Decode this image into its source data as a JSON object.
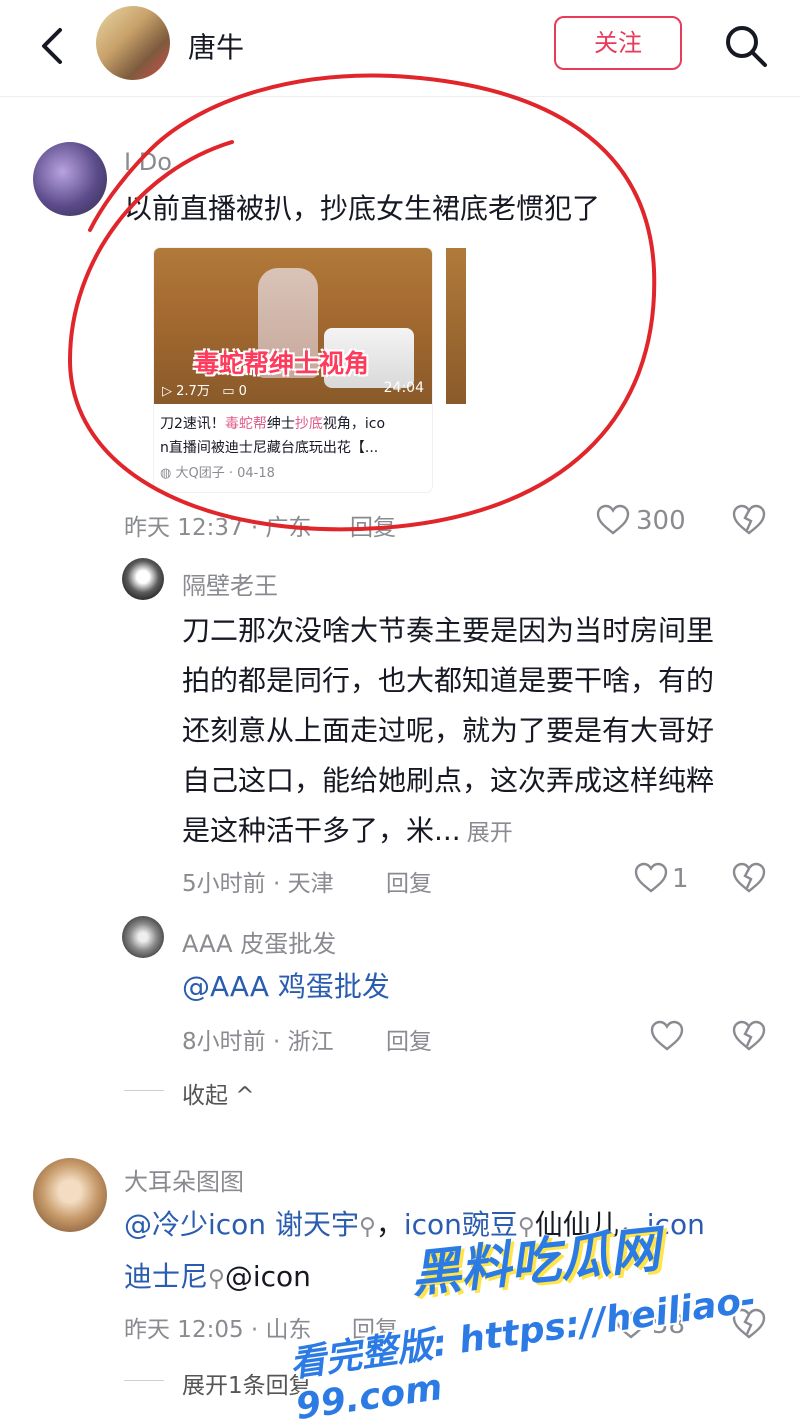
{
  "header": {
    "title": "唐牛",
    "follow_label": "关注"
  },
  "comments": [
    {
      "username": "I Do",
      "text": "以前直播被扒，抄底女生裙底老惯犯了",
      "video_card": {
        "overlay_title": "毒蛇帮绅士视角",
        "views": "2.7万",
        "comments": "0",
        "duration": "24:04",
        "caption_line1_parts": [
          "刀2速讯！",
          "毒蛇帮",
          "绅士",
          "抄底",
          "视角，ico"
        ],
        "caption_line2": "n直播间被迪士尼藏台底玩出花【...",
        "source": "大Q团子 · 04-18"
      },
      "meta": "昨天 12:37 · 广东",
      "reply_label": "回复",
      "likes": "300"
    }
  ],
  "replies": [
    {
      "username": "隔壁老王",
      "lines": [
        "刀二那次没啥大节奏主要是因为当时房间里",
        "拍的都是同行，也大都知道是要干啥，有的",
        "还刻意从上面走过呢，就为了要是有大哥好",
        "自己这口，能给她刷点，这次弄成这样纯粹",
        "是这种活干多了，米..."
      ],
      "expand_label": "展开",
      "meta": "5小时前 · 天津",
      "reply_label": "回复",
      "likes": "1"
    },
    {
      "username": "AAA 皮蛋批发",
      "text": "@AAA 鸡蛋批发",
      "meta": "8小时前 · 浙江",
      "reply_label": "回复"
    }
  ],
  "collapse_label": "收起",
  "comment2": {
    "username": "大耳朵图图",
    "line1_parts": [
      "@冷少icon 谢天宇",
      "，",
      "icon豌豆",
      "仙仙儿，",
      "icon"
    ],
    "line2_parts": [
      "迪士尼",
      "@icon"
    ],
    "meta": "昨天 12:05 · 山东",
    "reply_label": "回复",
    "likes": "58",
    "expand_label": "展开1条回复"
  },
  "watermark": {
    "brand": "黑料吃瓜网",
    "line": "看完整版: https://heiliao-99.com"
  },
  "colors": {
    "accent": "#e83a5a",
    "mention": "#2a5db0",
    "annotation": "#e0262b"
  }
}
